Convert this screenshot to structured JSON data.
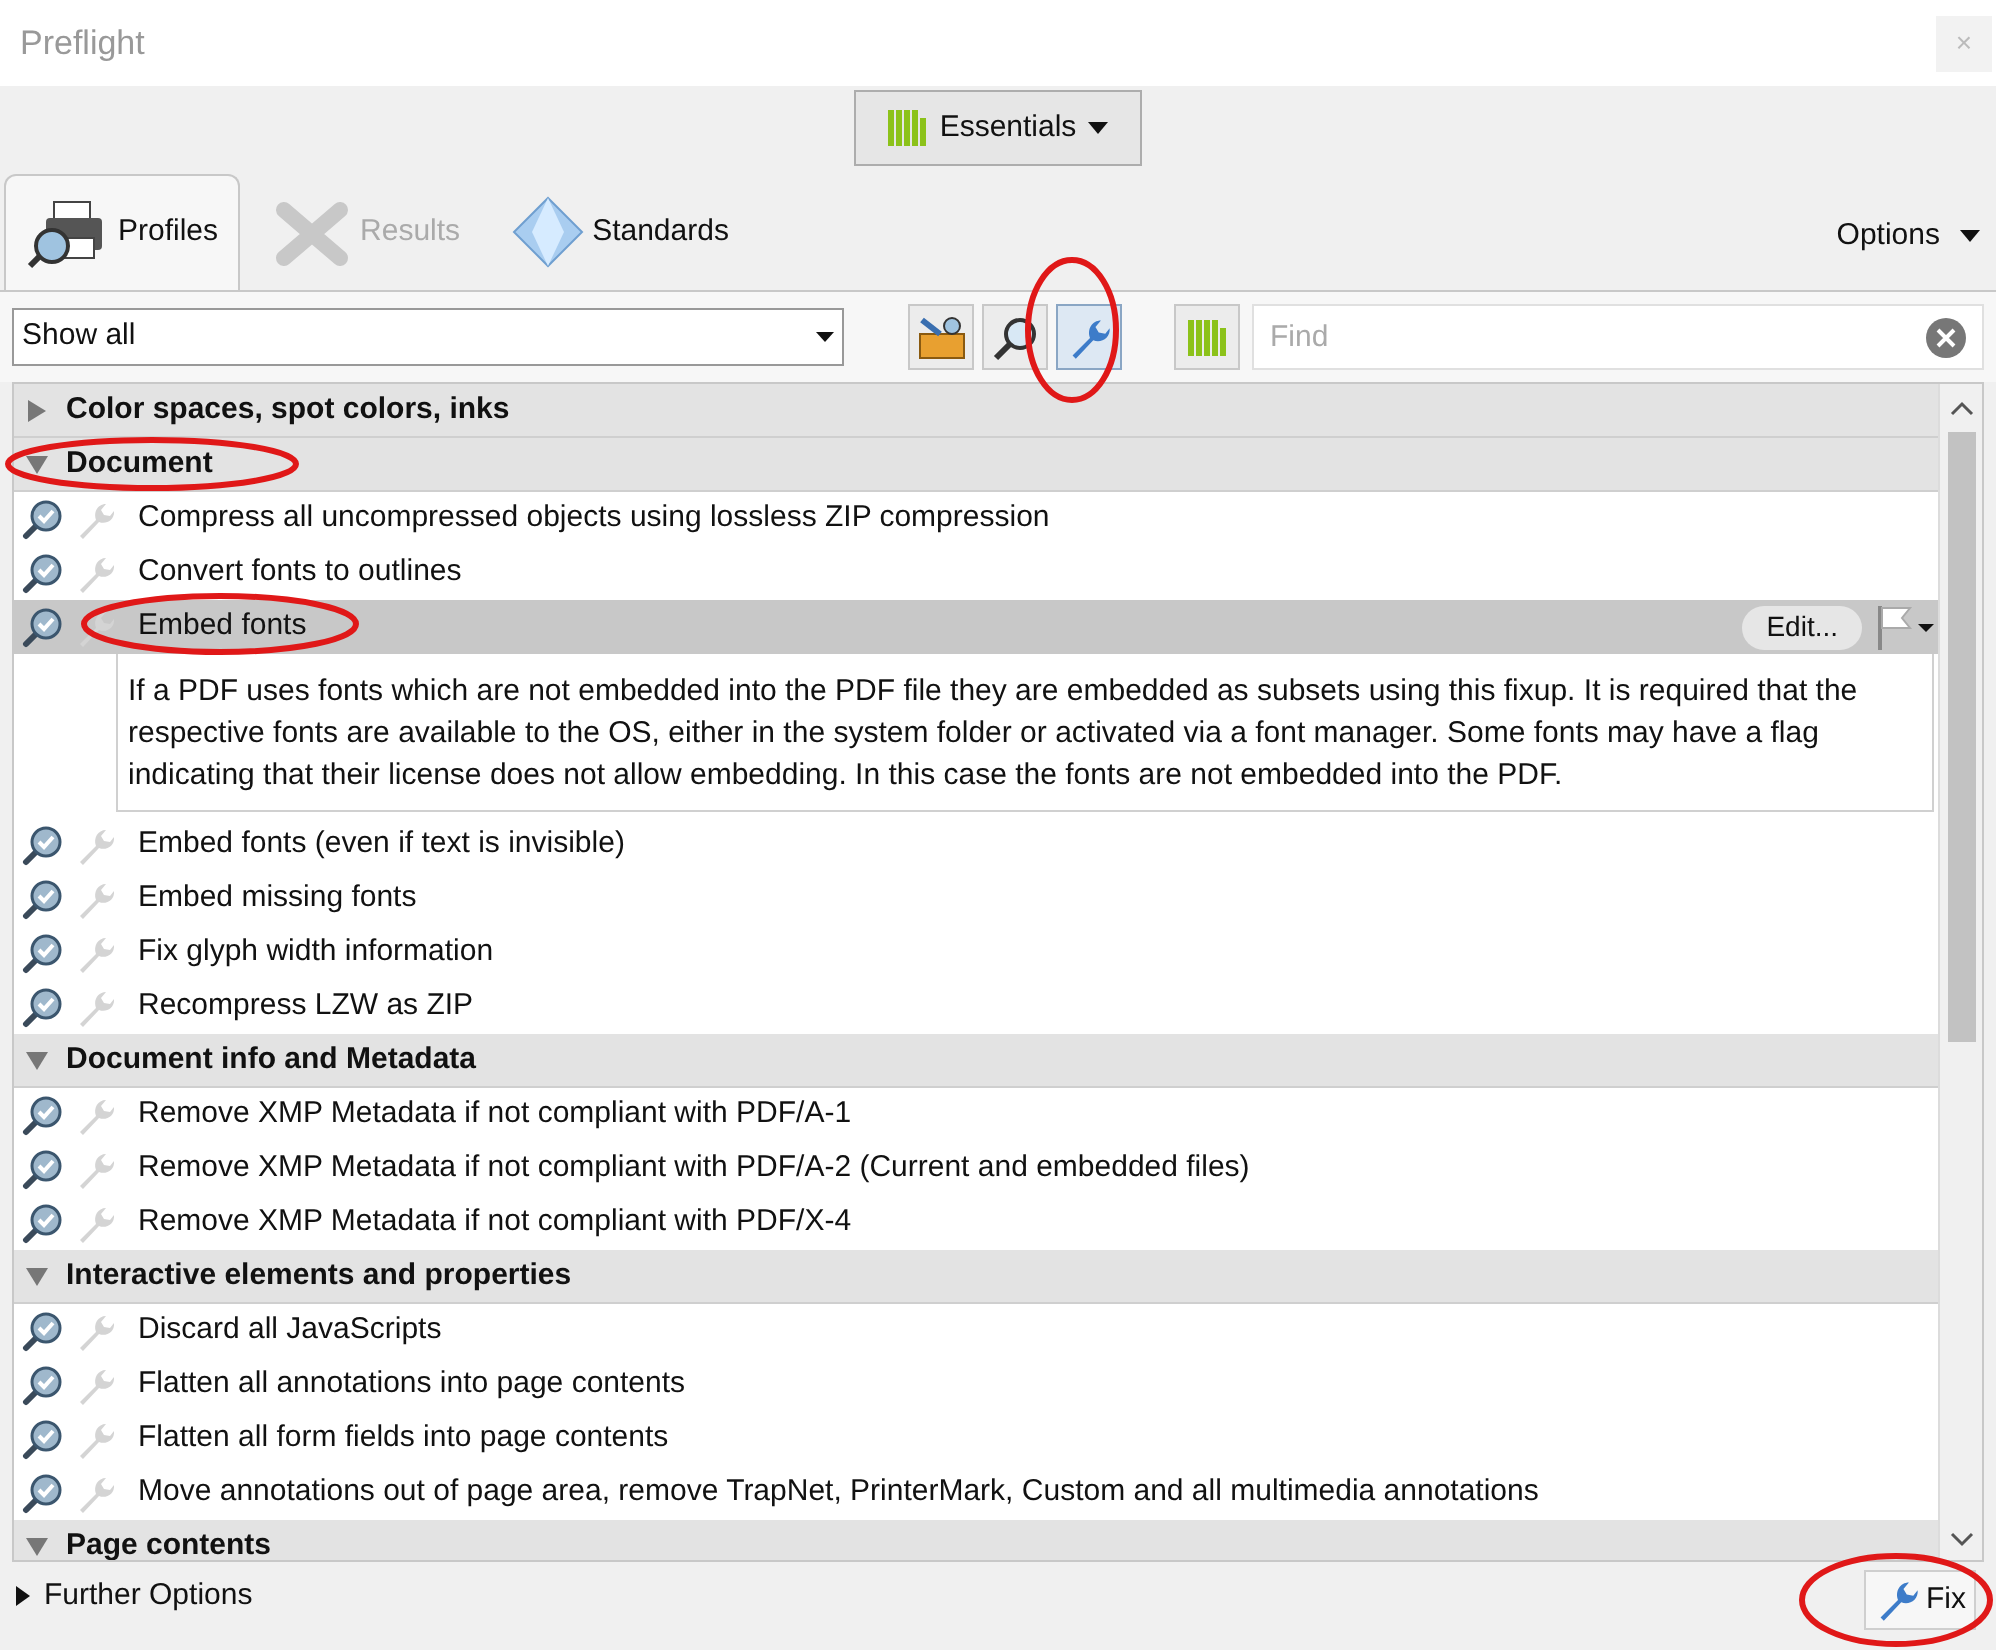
{
  "window": {
    "title": "Preflight",
    "close": "×"
  },
  "library_button": {
    "label": "Essentials"
  },
  "tabs": [
    {
      "label": "Profiles",
      "kind": "profiles",
      "selected": true,
      "disabled": false
    },
    {
      "label": "Results",
      "kind": "results",
      "selected": false,
      "disabled": true
    },
    {
      "label": "Standards",
      "kind": "standards",
      "selected": false,
      "disabled": false
    }
  ],
  "options_menu": {
    "label": "Options"
  },
  "filter_select": {
    "value": "Show all"
  },
  "toolbar_buttons": [
    {
      "kind": "toolbox",
      "selected": false
    },
    {
      "kind": "search",
      "selected": false
    },
    {
      "kind": "fixups",
      "selected": true
    },
    {
      "kind": "library",
      "selected": false
    }
  ],
  "find_field": {
    "placeholder": "Find"
  },
  "groups": [
    {
      "title": "Color spaces, spot colors, inks",
      "expanded": false
    },
    {
      "title": "Document",
      "expanded": true,
      "items": [
        {
          "label": "Compress all uncompressed objects using lossless ZIP compression",
          "selected": false
        },
        {
          "label": "Convert fonts to outlines",
          "selected": false
        },
        {
          "label": "Embed fonts",
          "selected": true,
          "edit_button": "Edit...",
          "description": "If a PDF uses fonts which are not embedded into the PDF file they are embedded as subsets using this fixup. It is required that the respective fonts are available to the OS, either in the system folder or activated via a font manager. Some fonts may have a flag indicating that their license does not allow embedding. In this case the fonts are not embedded into the PDF."
        },
        {
          "label": "Embed fonts (even if text is invisible)",
          "selected": false
        },
        {
          "label": "Embed missing fonts",
          "selected": false
        },
        {
          "label": "Fix glyph width information",
          "selected": false
        },
        {
          "label": "Recompress LZW as ZIP",
          "selected": false
        }
      ]
    },
    {
      "title": "Document info and Metadata",
      "expanded": true,
      "items": [
        {
          "label": "Remove XMP Metadata if not compliant with PDF/A-1",
          "selected": false
        },
        {
          "label": "Remove XMP Metadata if not compliant with PDF/A-2 (Current and embedded files)",
          "selected": false
        },
        {
          "label": "Remove XMP Metadata if not compliant with PDF/X-4",
          "selected": false
        }
      ]
    },
    {
      "title": "Interactive elements and properties",
      "expanded": true,
      "items": [
        {
          "label": "Discard all JavaScripts",
          "selected": false
        },
        {
          "label": "Flatten all annotations into page contents",
          "selected": false
        },
        {
          "label": "Flatten all form fields into page contents",
          "selected": false
        },
        {
          "label": "Move annotations out of page area, remove TrapNet, PrinterMark, Custom and all multimedia annotations",
          "selected": false
        }
      ]
    },
    {
      "title": "Page contents",
      "expanded": true
    }
  ],
  "further_options": {
    "label": "Further Options",
    "expanded": false
  },
  "fix_button": {
    "label": "Fix"
  }
}
